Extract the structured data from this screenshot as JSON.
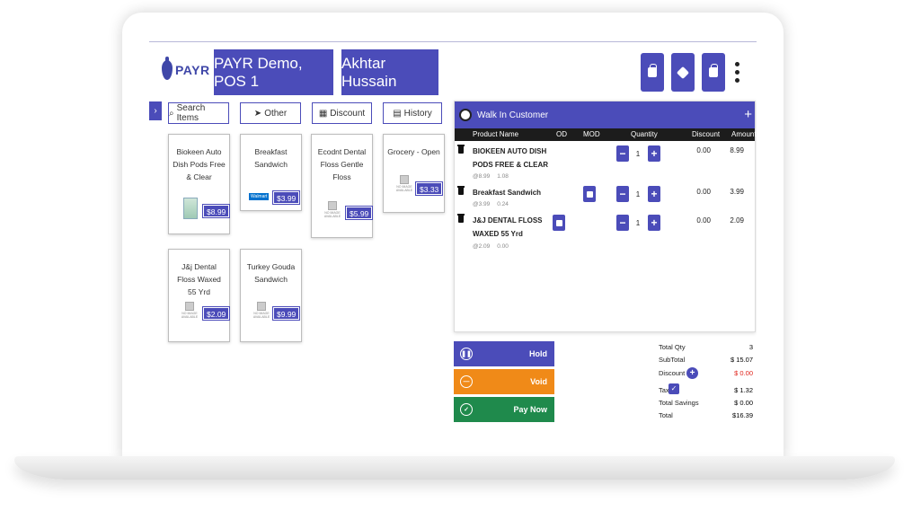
{
  "header": {
    "logo_text": "PAYR",
    "store_label": "PAYR Demo, POS 1",
    "user_label": "Akhtar Hussain",
    "icons": [
      "shopping-bag-icon",
      "tag-icon",
      "lock-icon",
      "more-vertical-icon"
    ]
  },
  "toolbar": {
    "search_label": "Search Items",
    "other_label": "Other",
    "discount_label": "Discount",
    "history_label": "History"
  },
  "products": [
    {
      "name": "Biokeen Auto Dish Pods Free & Clear",
      "price": "$8.99",
      "image": "product-photo"
    },
    {
      "name": "Breakfast Sandwich",
      "price": "$3.99",
      "image": "walmart-logo",
      "brand": "Walmart"
    },
    {
      "name": "Ecodnt Dental Floss Gentle Floss",
      "price": "$5.99",
      "image": "no-image"
    },
    {
      "name": "Grocery - Open",
      "price": "$3.33",
      "image": "no-image"
    },
    {
      "name": "J&j Dental Floss Waxed 55 Yrd",
      "price": "$2.09",
      "image": "no-image"
    },
    {
      "name": "Turkey Gouda Sandwich",
      "price": "$9.99",
      "image": "no-image"
    }
  ],
  "no_image_text": "NO IMAGE AVAILABLE",
  "cart": {
    "customer": "Walk In Customer",
    "columns": {
      "product": "Product Name",
      "od": "OD",
      "mod": "MOD",
      "quantity": "Quantity",
      "discount": "Discount",
      "amount": "Amount"
    },
    "items": [
      {
        "name": "BIOKEEN AUTO DISH PODS FREE & CLEAR",
        "unit": "@8.99",
        "tax": "1.08",
        "qty": "1",
        "discount": "0.00",
        "amount": "8.99"
      },
      {
        "name": "Breakfast Sandwich",
        "unit": "@3.99",
        "tax": "0.24",
        "qty": "1",
        "discount": "0.00",
        "amount": "3.99"
      },
      {
        "name": "J&J DENTAL FLOSS WAXED 55 Yrd",
        "unit": "@2.09",
        "tax": "0.00",
        "qty": "1",
        "discount": "0.00",
        "amount": "2.09"
      }
    ]
  },
  "actions": {
    "hold": "Hold",
    "void": "Void",
    "pay": "Pay Now"
  },
  "totals": {
    "qty_label": "Total Qty",
    "qty": "3",
    "subtotal_label": "SubTotal",
    "subtotal": "$ 15.07",
    "discount_label": "Discount",
    "discount": "$ 0.00",
    "tax_label": "Tax",
    "tax": "$ 1.32",
    "savings_label": "Total Savings",
    "savings": "$ 0.00",
    "total_label": "Total",
    "total": "$16.39"
  },
  "colors": {
    "primary": "#4b4cb9",
    "void": "#f08a18",
    "pay": "#1f8a4c",
    "negative": "#e0241b"
  }
}
